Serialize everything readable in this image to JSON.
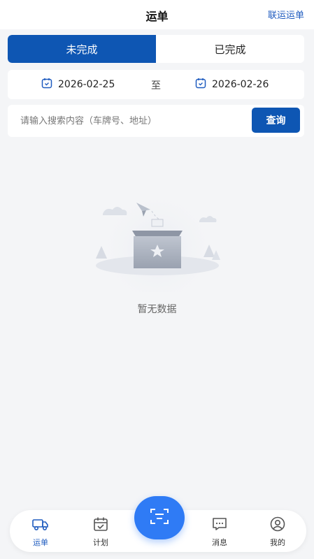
{
  "header": {
    "title": "运单",
    "link_label": "联运运单"
  },
  "tabs": [
    {
      "label": "未完成",
      "active": true
    },
    {
      "label": "已完成",
      "active": false
    }
  ],
  "date_range": {
    "from": "2026-02-25",
    "separator": "至",
    "to": "2026-02-26",
    "icon": "calendar-icon"
  },
  "search": {
    "placeholder": "请输入搜索内容（车牌号、地址）",
    "value": "",
    "button_label": "查询"
  },
  "empty_state": {
    "text": "暂无数据",
    "illustration": "empty-box-illustration"
  },
  "bottom_nav": {
    "items": [
      {
        "label": "运单",
        "icon": "truck-icon",
        "active": true
      },
      {
        "label": "计划",
        "icon": "calendar-check-icon",
        "active": false
      },
      {
        "label": "消息",
        "icon": "message-icon",
        "active": false
      },
      {
        "label": "我的",
        "icon": "user-icon",
        "active": false
      }
    ],
    "fab_icon": "scan-icon"
  },
  "colors": {
    "primary": "#0e56b3",
    "fab": "#2f7bf5",
    "background": "#f4f5f7"
  }
}
